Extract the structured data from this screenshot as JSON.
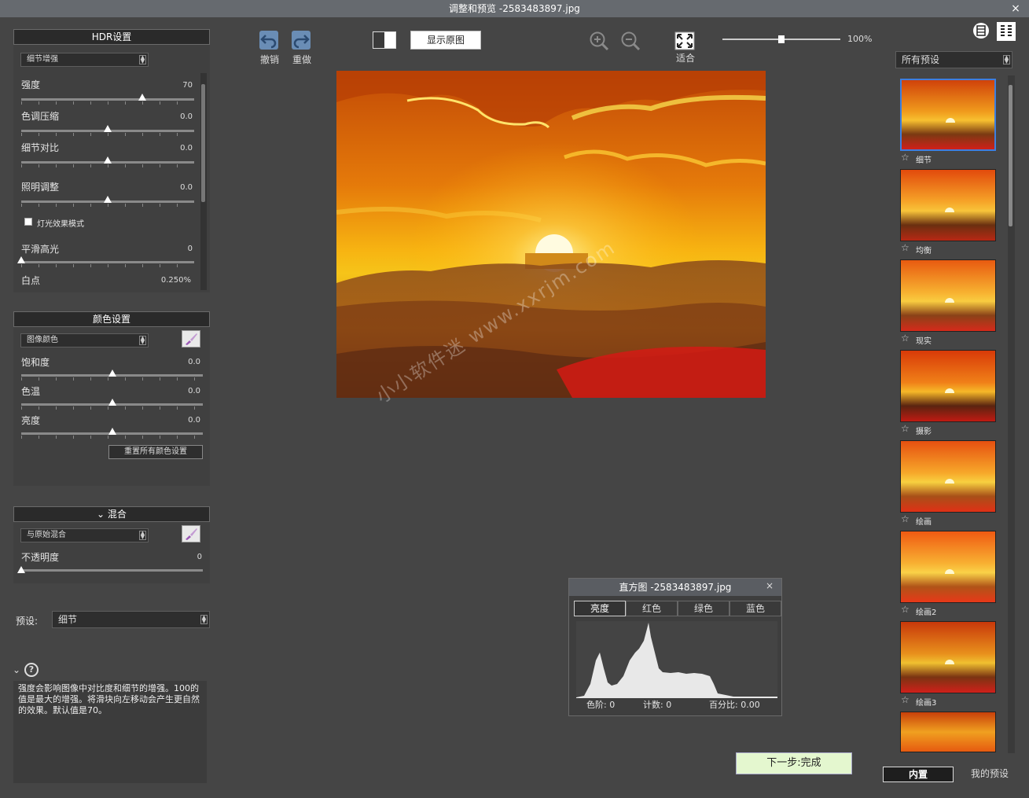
{
  "window": {
    "title": "调整和预览 -2583483897.jpg",
    "close": "×"
  },
  "hdr": {
    "header": "HDR设置",
    "mode": "细节增强",
    "sliders": [
      {
        "label": "强度",
        "value": "70",
        "pos": 0.7
      },
      {
        "label": "色调压缩",
        "value": "0.0",
        "pos": 0.5
      },
      {
        "label": "细节对比",
        "value": "0.0",
        "pos": 0.5
      },
      {
        "label": "照明调整",
        "value": "0.0",
        "pos": 0.5
      }
    ],
    "checkbox_label": "灯光效果模式",
    "smooth": {
      "label": "平滑高光",
      "value": "0",
      "pos": 0
    },
    "white": {
      "label": "白点",
      "value": "0.250%"
    }
  },
  "color": {
    "header": "颜色设置",
    "mode": "图像颜色",
    "sliders": [
      {
        "label": "饱和度",
        "value": "0.0",
        "pos": 0.5
      },
      {
        "label": "色温",
        "value": "0.0",
        "pos": 0.5
      },
      {
        "label": "亮度",
        "value": "0.0",
        "pos": 0.5
      }
    ],
    "reset": "重置所有颜色设置"
  },
  "blend": {
    "header": "混合",
    "mode": "与原始混合",
    "opacity_label": "不透明度",
    "opacity_value": "0",
    "opacity_pos": 0
  },
  "preset_row": {
    "label": "预设:",
    "value": "细节"
  },
  "help": {
    "text": "强度会影响图像中对比度和细节的增强。100的值是最大的增强。将滑块向左移动会产生更自然的效果。默认值是70。"
  },
  "toolbar": {
    "undo": "撤销",
    "redo": "重做",
    "show_original": "显示原图",
    "fit": "适合",
    "zoom": "100%",
    "zoom_pos": 0.5
  },
  "watermark": "小小软件迷 www.xxrjm.com",
  "histogram": {
    "title": "直方图 -2583483897.jpg",
    "tabs": [
      "亮度",
      "红色",
      "绿色",
      "蓝色"
    ],
    "level_label": "色阶: 0",
    "count_label": "计数: 0",
    "percent_label": "百分比: 0.00"
  },
  "next_button": "下一步:完成",
  "presets": {
    "dropdown": "所有预设",
    "items": [
      "细节",
      "均衡",
      "现实",
      "摄影",
      "绘画",
      "绘画2",
      "绘画3"
    ]
  },
  "bottom_tabs": [
    "内置",
    "我的预设"
  ],
  "colors": {
    "accent": "#3d7fe0",
    "next_bg": "#e4f7cf"
  }
}
